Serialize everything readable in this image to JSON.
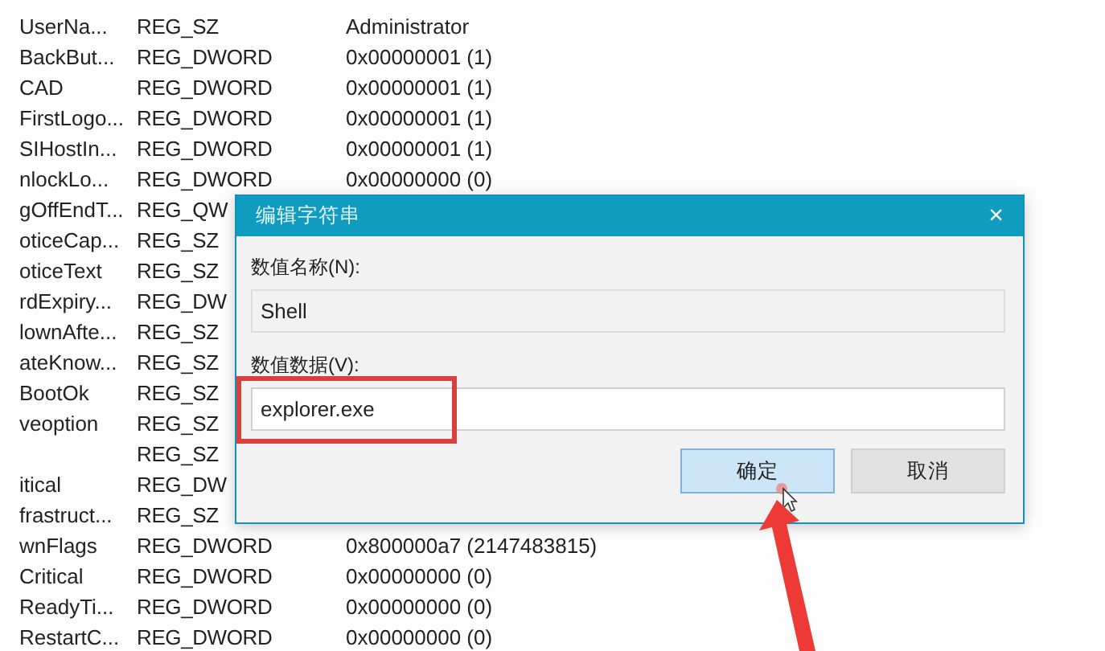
{
  "rows": [
    {
      "name": "UserNa...",
      "type": "REG_SZ",
      "data": "Administrator"
    },
    {
      "name": "BackBut...",
      "type": "REG_DWORD",
      "data": "0x00000001 (1)"
    },
    {
      "name": "CAD",
      "type": "REG_DWORD",
      "data": "0x00000001 (1)"
    },
    {
      "name": "FirstLogo...",
      "type": "REG_DWORD",
      "data": "0x00000001 (1)"
    },
    {
      "name": "SIHostIn...",
      "type": "REG_DWORD",
      "data": "0x00000001 (1)"
    },
    {
      "name": "nlockLo...",
      "type": "REG_DWORD",
      "data": "0x00000000 (0)"
    },
    {
      "name": "gOffEndT...",
      "type": "REG_QW"
    },
    {
      "name": "oticeCap...",
      "type": "REG_SZ"
    },
    {
      "name": "oticeText",
      "type": "REG_SZ"
    },
    {
      "name": "rdExpiry...",
      "type": "REG_DW"
    },
    {
      "name": "lownAfte...",
      "type": "REG_SZ"
    },
    {
      "name": "ateKnow...",
      "type": "REG_SZ"
    },
    {
      "name": "BootOk",
      "type": "REG_SZ"
    },
    {
      "name": "veoption",
      "type": "REG_SZ"
    },
    {
      "type": "REG_SZ"
    },
    {
      "name": "itical",
      "type": "REG_DW"
    },
    {
      "name": "frastruct...",
      "type": "REG_SZ"
    },
    {
      "name": "wnFlags",
      "type": "REG_DWORD",
      "data": "0x800000a7 (2147483815)"
    },
    {
      "name": "Critical",
      "type": "REG_DWORD",
      "data": "0x00000000 (0)"
    },
    {
      "name": "ReadyTi...",
      "type": "REG_DWORD",
      "data": "0x00000000 (0)"
    },
    {
      "name": "RestartC...",
      "type": "REG_DWORD",
      "data": "0x00000000 (0)"
    }
  ],
  "dialog": {
    "title": "编辑字符串",
    "close": "×",
    "name_label": "数值名称(N):",
    "name_value": "Shell",
    "data_label": "数值数据(V):",
    "data_value": "explorer.exe",
    "buttons": [
      {
        "label": "确定",
        "kind": "primary"
      },
      {
        "label": "取消",
        "kind": "normal"
      }
    ]
  }
}
